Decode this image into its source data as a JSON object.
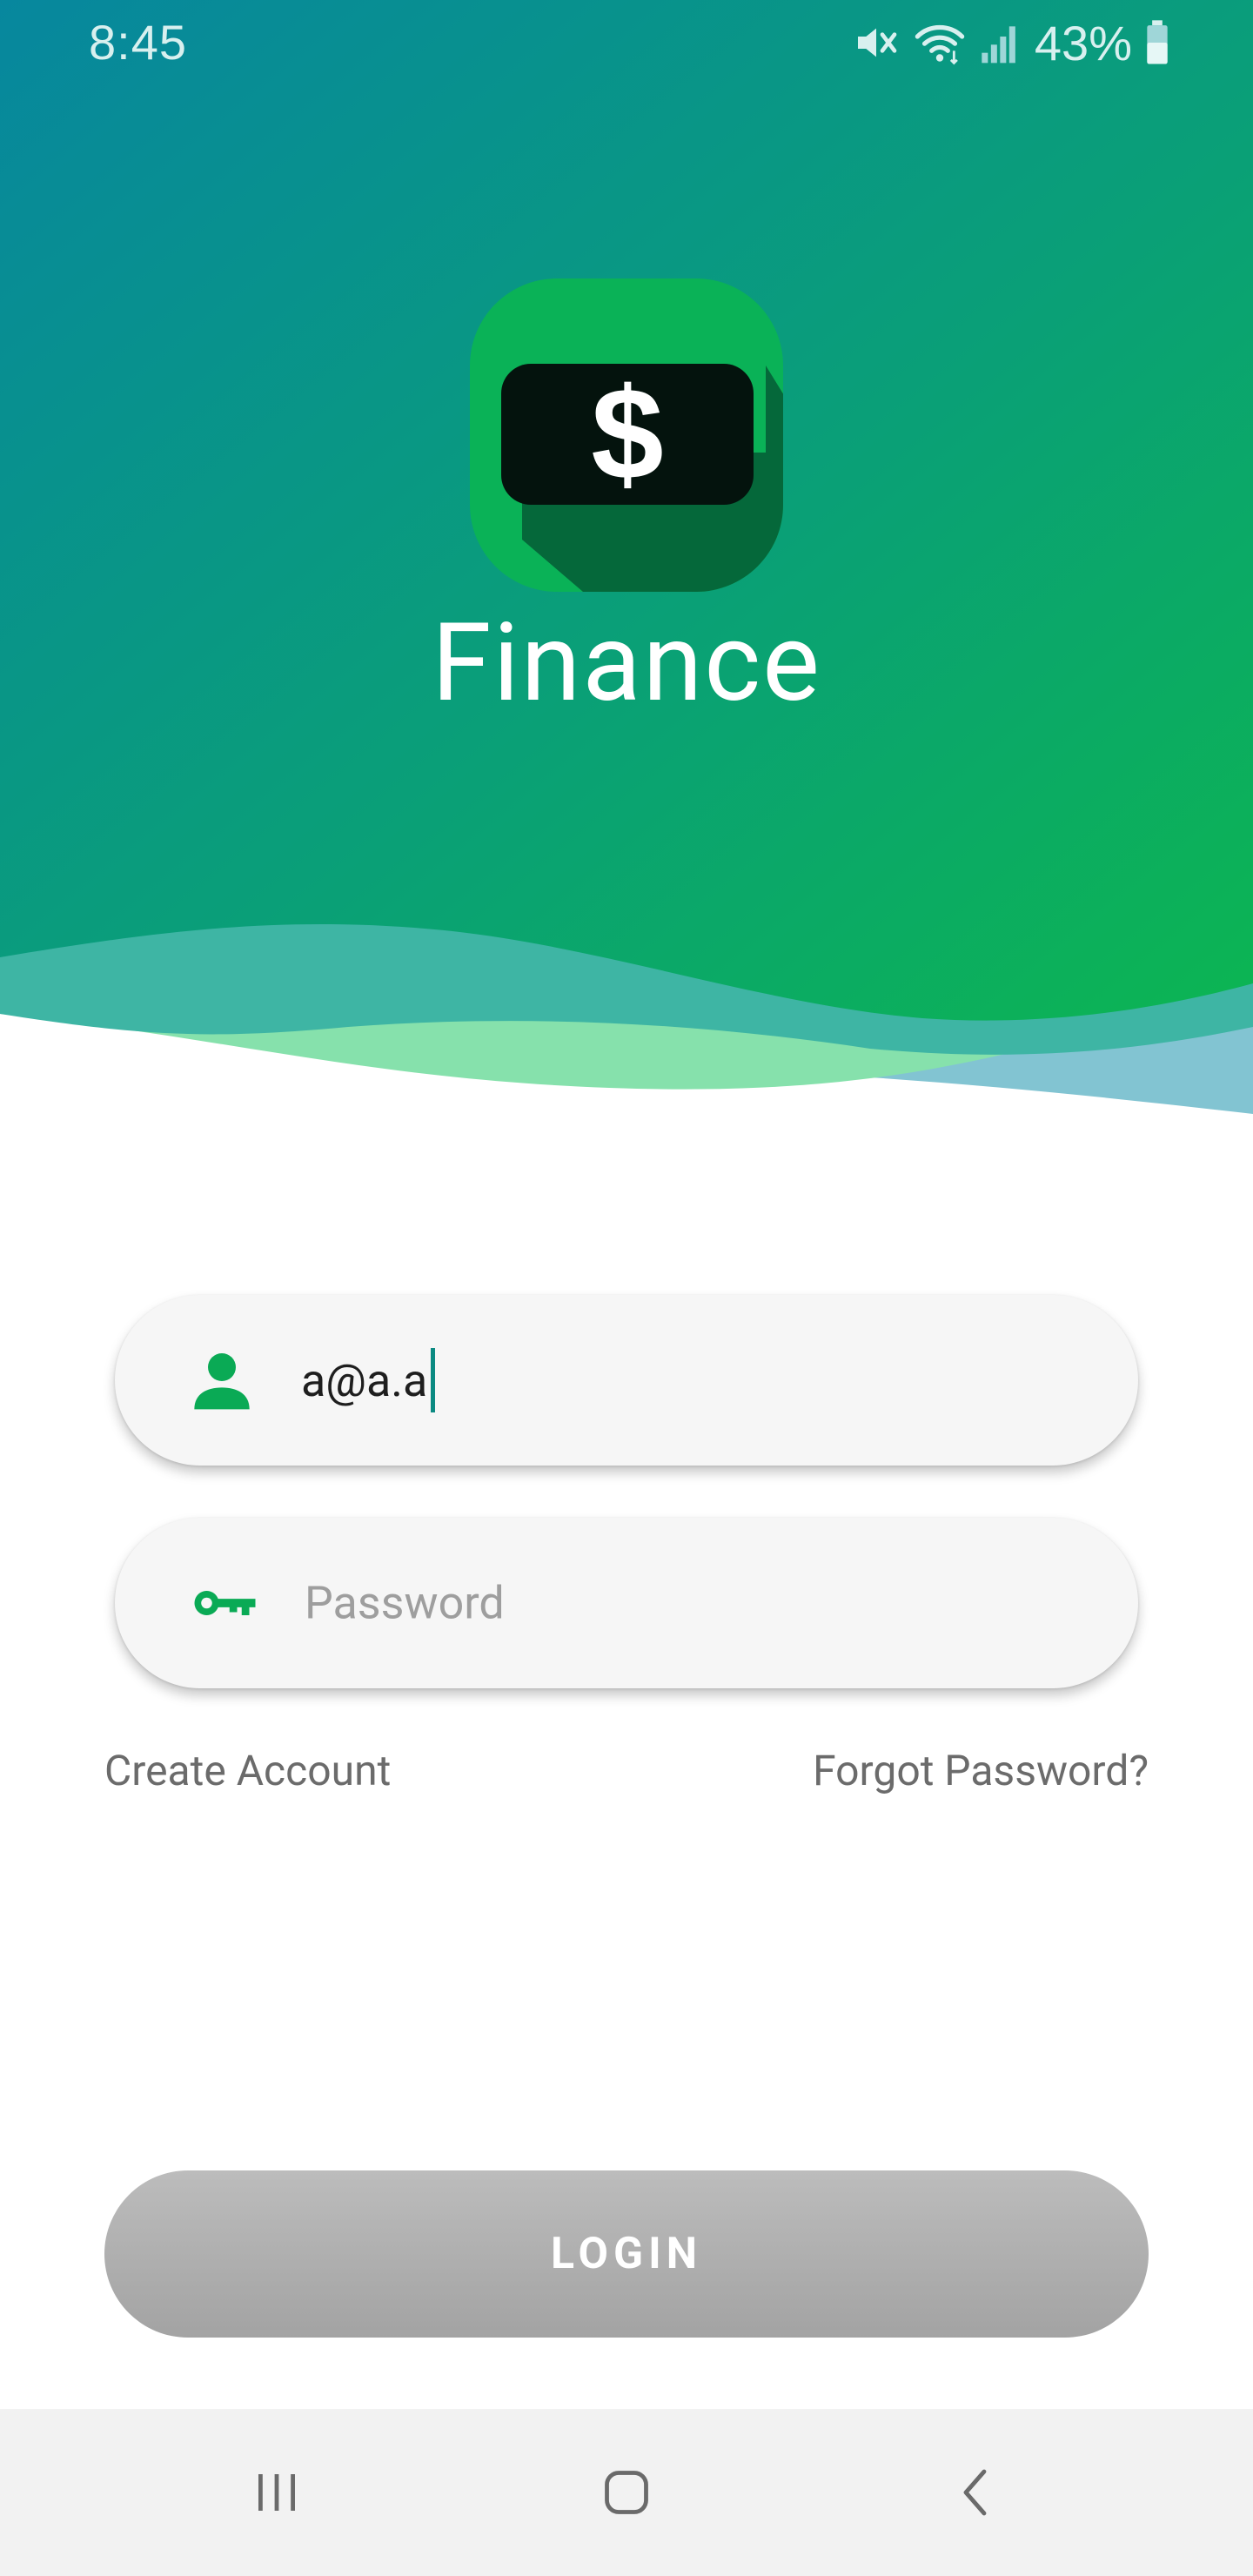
{
  "status_bar": {
    "time": "8:45",
    "battery_percent": "43%",
    "icons": [
      "mute-icon",
      "wifi-icon",
      "signal-icon",
      "battery-icon"
    ]
  },
  "app": {
    "title": "Finance",
    "logo_symbol": "$",
    "logo_icon": "dollar-bill-icon"
  },
  "login_form": {
    "email_value": "a@a.a",
    "email_icon": "person-icon",
    "password_placeholder": "Password",
    "password_icon": "key-icon",
    "create_account_label": "Create Account",
    "forgot_password_label": "Forgot Password?",
    "login_label": "LOGIN"
  },
  "nav_bar": {
    "recents_icon": "recents-icon",
    "home_icon": "home-icon",
    "back_icon": "back-icon"
  },
  "colors": {
    "gradient_start": "#07879c",
    "gradient_end": "#0db357",
    "accent_green": "#0aaa55",
    "caret_teal": "#0c8a82",
    "button_gray": "#ababab",
    "link_gray": "#6b6b6b"
  }
}
